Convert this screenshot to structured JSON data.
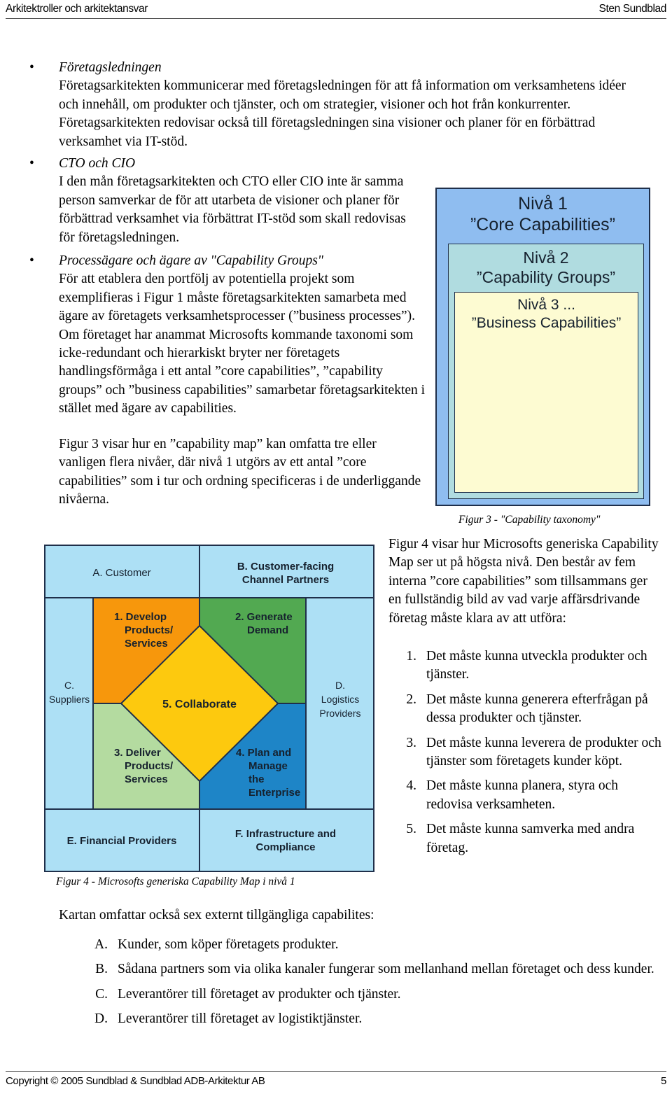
{
  "header": {
    "left": "Arkitektroller och arkitektansvar",
    "right": "Sten Sundblad"
  },
  "footer": {
    "copyright": "Copyright © 2005 Sundblad & Sundblad ADB-Arkitektur AB",
    "page_number": "5"
  },
  "bullets": [
    {
      "marker": "•",
      "title": "Företagsledningen",
      "text": "Företagsarkitekten kommunicerar med företagsledningen för att få information om verksamhetens idéer och innehåll, om produkter och tjänster, och om strategier, visioner och hot från konkurrenter. Företagsarkitekten redovisar också till företagsledningen sina visioner och planer för en förbättrad verksamhet via IT-stöd."
    },
    {
      "marker": "•",
      "title": "CTO och CIO",
      "text": "I den mån företagsarkitekten och CTO eller CIO inte är samma person samverkar de för att utarbeta de visioner och planer för förbättrad verksamhet via förbättrat IT-stöd som skall redovisas för företagsledningen."
    },
    {
      "marker": "•",
      "title": "Processägare och ägare av \"Capability Groups\"",
      "text": "För att etablera den portfölj av potentiella projekt som exemplifieras i Figur 1 måste företagsarkitekten samarbeta med ägare av företagets verksamhetsprocesser (”business processes”). Om företaget har anammat Microsofts kommande taxonomi som icke-redundant och hierarkiskt bryter ner företagets handlingsförmåga i ett antal ”core capabilities”, ”capability groups” och ”business capabilities” samarbetar företagsarkitekten i stället med ägare av capabilities."
    }
  ],
  "paragraphs": {
    "figur3_intro": "Figur 3  visar hur en ”capability map” kan omfatta tre eller vanligen flera nivåer, där nivå 1 utgörs av ett antal ”core capabilities” som i tur och ordning specificeras i de underliggande nivåerna.",
    "figur4_intro": "Figur 4 visar hur Microsofts generiska Capability Map ser ut på högsta nivå. Den består av fem interna ”core capabilities” som tillsammans ger en fullständig bild av vad varje affärsdrivande företag måste klara av att utföra:",
    "kartan_intro": "Kartan omfattar också sex externt tillgängliga capabilites:"
  },
  "core_capabilities_list": [
    {
      "marker": "1.",
      "text": "Det måste kunna utveckla produkter och tjänster."
    },
    {
      "marker": "2.",
      "text": "Det måste kunna generera efterfrågan på dessa produkter och tjänster."
    },
    {
      "marker": "3.",
      "text": "Det måste kunna leverera de produkter och tjänster som företagets kunder köpt."
    },
    {
      "marker": "4.",
      "text": "Det måste kunna planera, styra och redovisa verksamheten."
    },
    {
      "marker": "5.",
      "text": "Det måste kunna samverka med andra företag."
    }
  ],
  "external_capabilities_list": [
    {
      "marker": "A.",
      "text": "Kunder, som köper företagets produkter."
    },
    {
      "marker": "B.",
      "text": "Sådana partners som via olika kanaler fungerar som mellanhand mellan företaget och dess kunder."
    },
    {
      "marker": "C.",
      "text": "Leverantörer till företaget av produkter och tjänster."
    },
    {
      "marker": "D.",
      "text": "Leverantörer till företaget av logistiktjänster."
    }
  ],
  "figures": {
    "fig3": {
      "caption": "Figur 3 - \"Capability taxonomy\"",
      "level1_line1": "Nivå 1",
      "level1_line2": "”Core Capabilities”",
      "level2_line1": "Nivå 2",
      "level2_line2": "”Capability Groups”",
      "level3_line1": "Nivå 3 ...",
      "level3_line2": "”Business Capabilities”",
      "colors": {
        "level1": "#8fbdf0",
        "level2": "#b0dce0",
        "level3": "#fdfbd2",
        "border": "#1f2f4a"
      }
    },
    "fig4": {
      "caption": "Figur 4 - Microsofts generiska Capability Map i nivå 1",
      "top_left": "A. Customer",
      "top_right_line1": "B. Customer-facing",
      "top_right_line2": "Channel Partners",
      "left_line1": "C.",
      "left_line2": "Suppliers",
      "right_line1": "D.",
      "right_line2": "Logistics",
      "right_line3": "Providers",
      "bottom_left": "E. Financial Providers",
      "bottom_right_line1": "F. Infrastructure and",
      "bottom_right_line2": "Compliance",
      "q1_line1": "1.  Develop",
      "q1_line2": "Products/",
      "q1_line3": "Services",
      "q2_line1": "2.  Generate",
      "q2_line2": "Demand",
      "q3_line1": "3.  Deliver",
      "q3_line2": "Products/",
      "q3_line3": "Services",
      "q4_line1": "4.  Plan and",
      "q4_line2": "Manage",
      "q4_line3": "the",
      "q4_line4": "Enterprise",
      "center": "5.  Collaborate",
      "colors": {
        "outer": "#ade0f5",
        "q1_orange": "#f7970c",
        "q2_green": "#52a951",
        "q3_lightgreen": "#b4dba0",
        "q4_blue": "#1e85c7",
        "center_yellow": "#fdc90e",
        "border": "#1f2f4a"
      }
    }
  }
}
